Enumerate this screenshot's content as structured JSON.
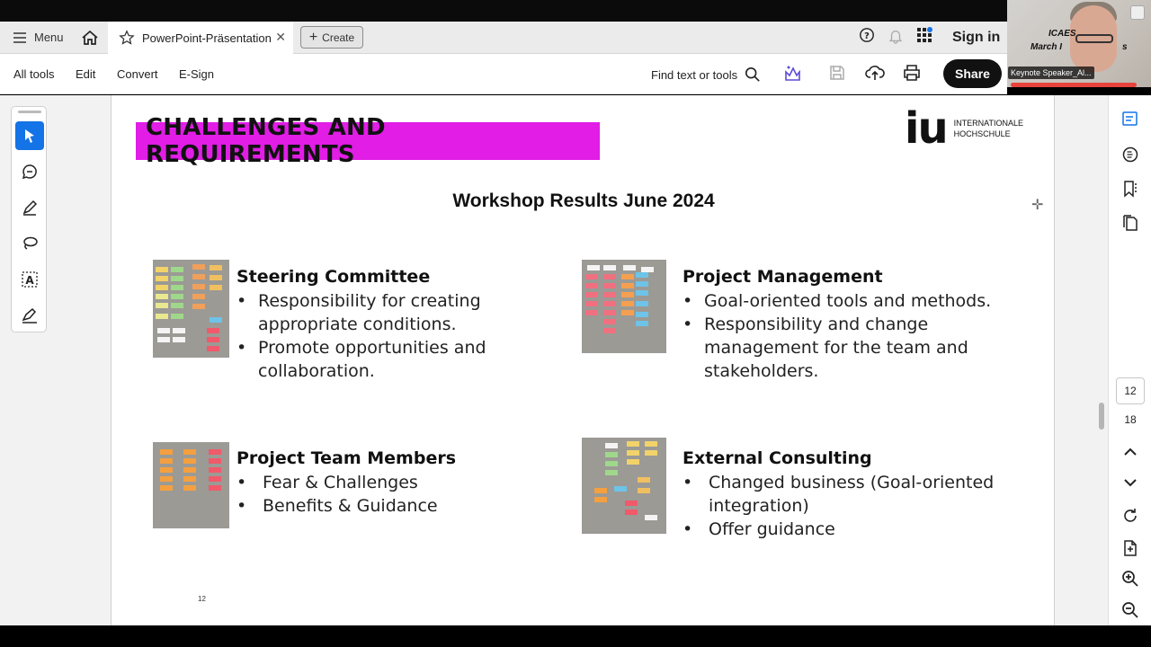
{
  "tabbar": {
    "menu_label": "Menu",
    "tab_title": "PowerPoint-Präsentation",
    "create_label": "Create",
    "signin_label": "Sign in"
  },
  "toolbar": {
    "items": [
      "All tools",
      "Edit",
      "Convert",
      "E-Sign"
    ],
    "find_label": "Find text or tools",
    "share_label": "Share"
  },
  "video": {
    "line1": "ICAES",
    "line2": "March I",
    "line3": "s",
    "speaker_label": "Keynote Speaker_Al..."
  },
  "slide": {
    "title": "CHALLENGES AND REQUIREMENTS",
    "logo_text": "iu",
    "logo_line1": "INTERNATIONALE",
    "logo_line2": "HOCHSCHULE",
    "subtitle": "Workshop Results June 2024",
    "sections": [
      {
        "heading": "Steering Committee",
        "bullets": [
          "Responsibility for creating appropriate conditions.",
          "Promote opportunities and collaboration."
        ]
      },
      {
        "heading": "Project Management",
        "bullets": [
          "Goal-oriented tools and methods.",
          "Responsibility and change management for the team and stakeholders."
        ]
      },
      {
        "heading": "Project Team Members",
        "bullets": [
          "Fear & Challenges",
          "Benefits & Guidance"
        ]
      },
      {
        "heading": "External Consulting",
        "bullets": [
          "Changed business (Goal-oriented integration)",
          "Offer guidance"
        ]
      }
    ],
    "page_number": "12"
  },
  "navigation": {
    "current_page": "12",
    "total_pages": "18"
  },
  "colors": {
    "title_bg": "#e11de6",
    "accent_blue": "#1473e6",
    "share_bg": "#111111"
  },
  "icons": [
    "menu-icon",
    "home-icon",
    "star-icon",
    "close-icon",
    "plus-icon",
    "help-icon",
    "bell-icon",
    "apps-icon",
    "search-icon",
    "ai-assistant-icon",
    "save-icon",
    "upload-icon",
    "print-icon",
    "select-icon",
    "comment-icon",
    "draw-icon",
    "lasso-icon",
    "text-select-icon",
    "signature-icon",
    "comments-panel-icon",
    "email-icon",
    "bookmark-icon",
    "pages-icon",
    "chevron-up-icon",
    "chevron-down-icon",
    "refresh-icon",
    "document-icon",
    "zoom-in-icon",
    "zoom-out-icon"
  ]
}
